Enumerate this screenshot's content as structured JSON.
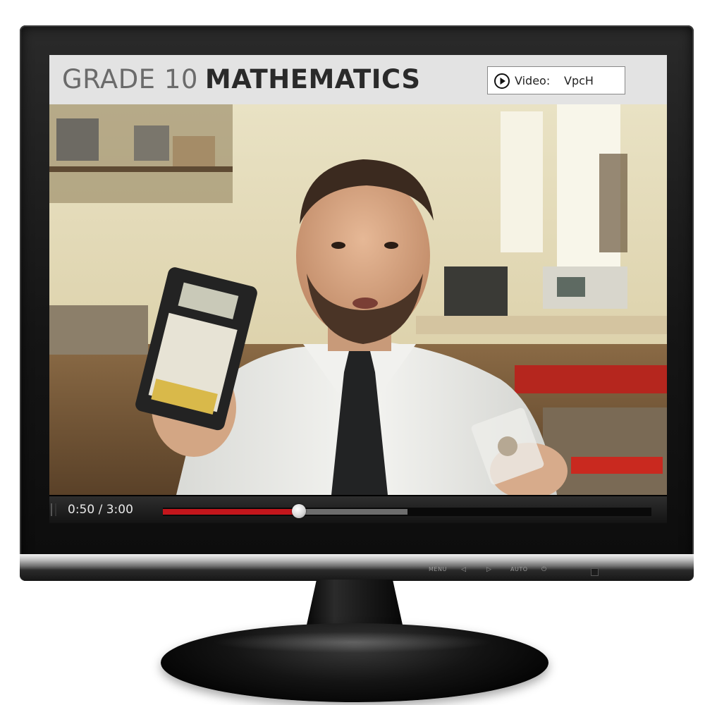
{
  "header": {
    "grade": "GRADE 10",
    "subject": "MATHEMATICS",
    "video_badge": {
      "icon": "play-circle-icon",
      "label": "Video:",
      "code": "VpcH"
    }
  },
  "player": {
    "time_display": "0:50 / 3:00",
    "progress_fraction": 0.2778,
    "buffered_fraction": 0.5,
    "colors": {
      "played": "#c4161c",
      "buffered": "#6e6e6e"
    }
  },
  "monitor": {
    "controls": {
      "menu": "MENU",
      "left": "◁",
      "right": "▷",
      "auto": "AUTO",
      "power": "⏻"
    }
  }
}
